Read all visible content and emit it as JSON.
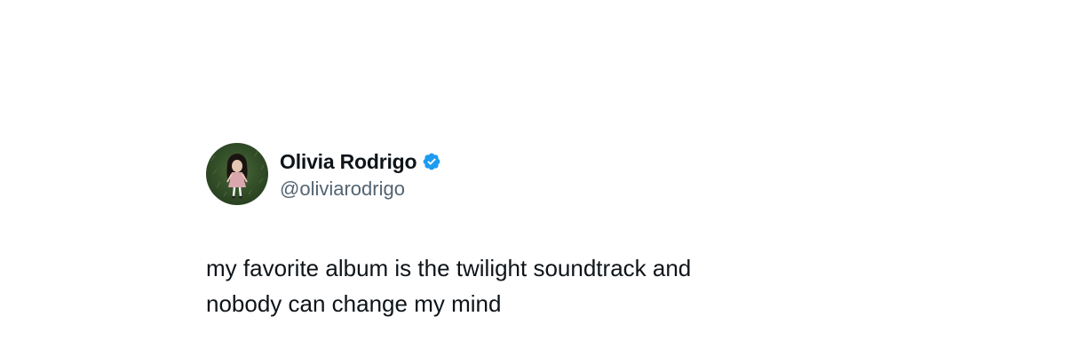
{
  "tweet": {
    "author": {
      "display_name": "Olivia Rodrigo",
      "handle": "@oliviarodrigo",
      "verified": true,
      "avatar_icon": "profile-photo"
    },
    "text": "my favorite album is the twilight soundtrack and\nnobody can change my mind"
  },
  "colors": {
    "text_primary": "#0f1419",
    "text_secondary": "#536471",
    "verified_badge": "#1d9bf0",
    "background": "#ffffff"
  }
}
